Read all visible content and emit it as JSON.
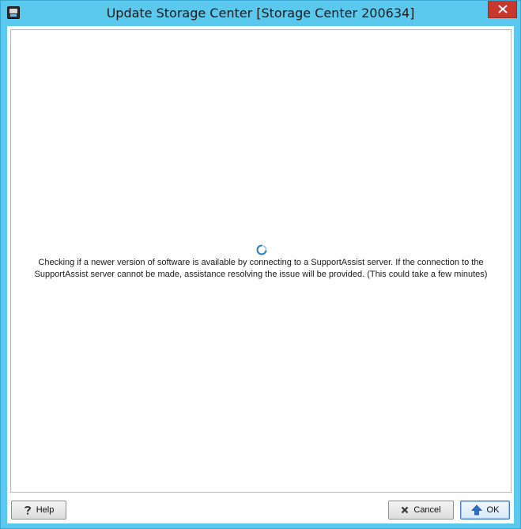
{
  "window": {
    "title": "Update Storage Center [Storage Center 200634]"
  },
  "content": {
    "message_line1": "Checking if a newer version of software is available by connecting to a SupportAssist server. If the connection to the",
    "message_line2": "SupportAssist server cannot be made, assistance resolving the issue will be provided. (This could take a few minutes)"
  },
  "buttons": {
    "help_label": "Help",
    "cancel_label": "Cancel",
    "ok_label": "OK"
  },
  "icons": {
    "app": "storage-manager-app-icon",
    "close": "close-icon",
    "spinner": "loading-spinner-icon",
    "help": "question-mark-icon",
    "cancel": "x-icon",
    "ok": "up-arrow-icon"
  },
  "colors": {
    "titlebar": "#5bc9ee",
    "close_button": "#c7372b",
    "ok_accent": "#3d7bd0",
    "spinner": "#2c7fbf"
  }
}
